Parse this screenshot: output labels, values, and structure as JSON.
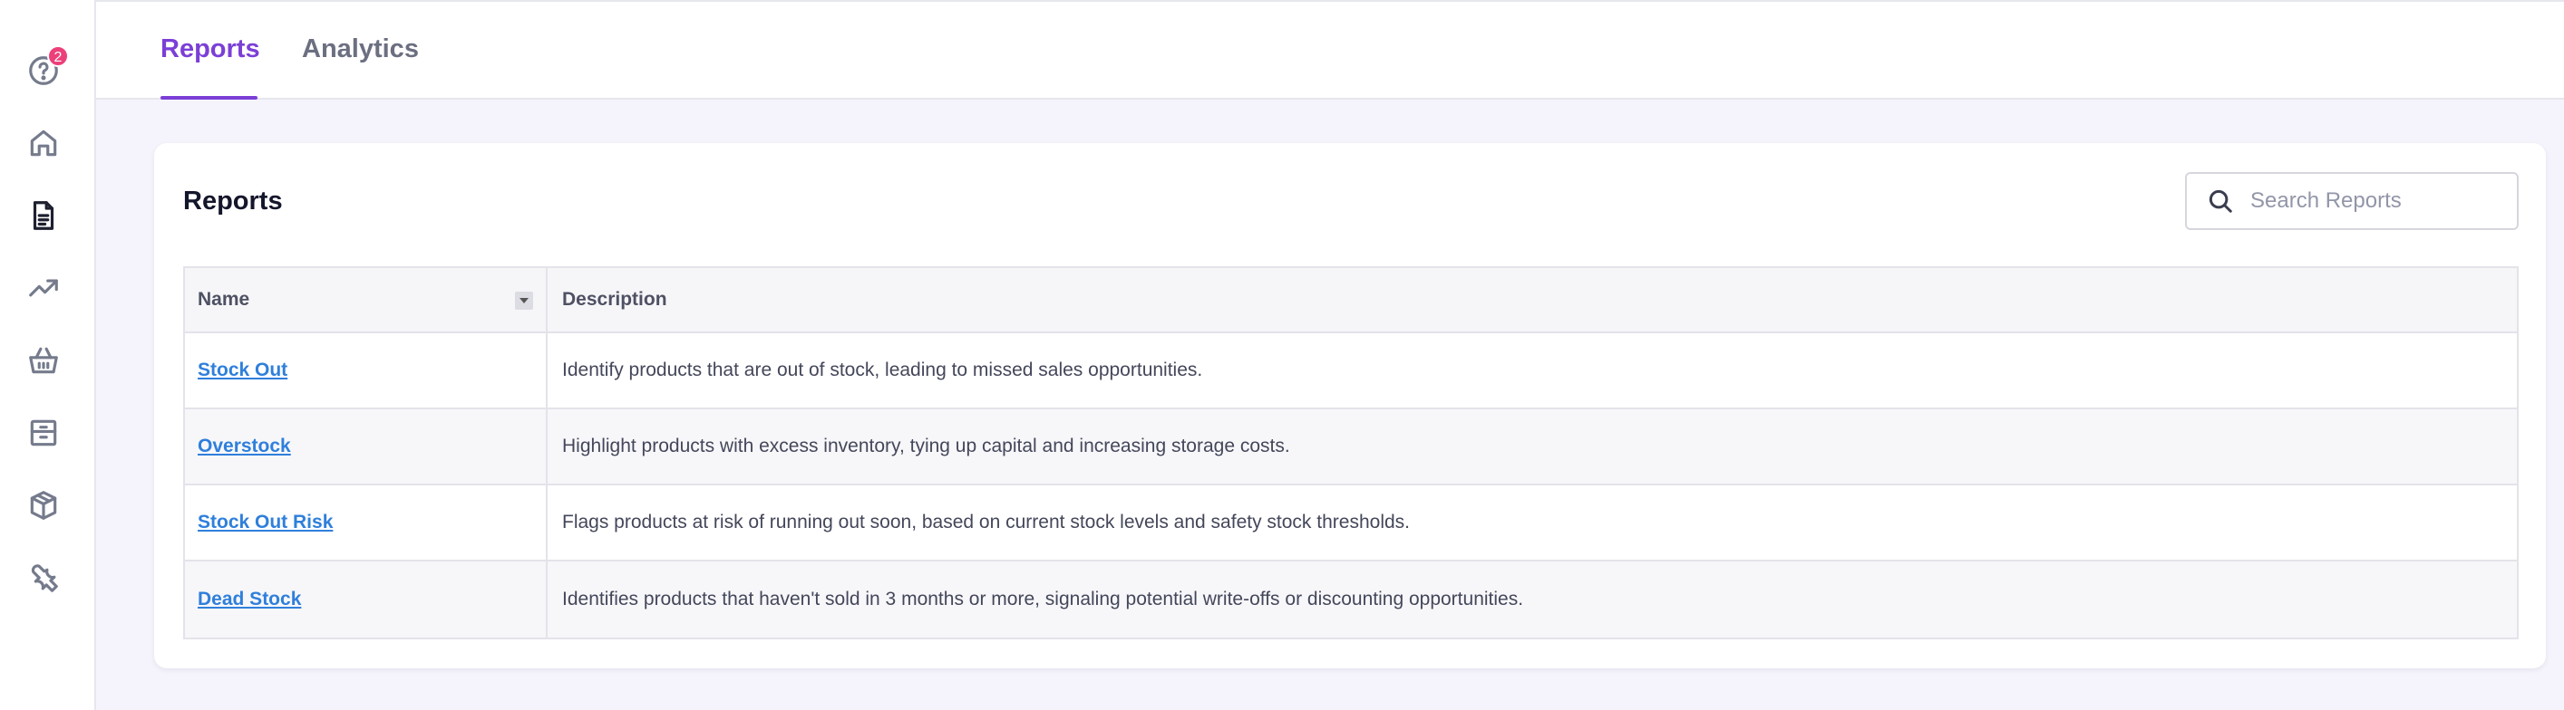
{
  "sidebar": {
    "help_badge_count": "2",
    "items": [
      {
        "icon": "help-circle-icon"
      },
      {
        "icon": "home-icon"
      },
      {
        "icon": "document-icon",
        "active": true
      },
      {
        "icon": "trending-up-icon"
      },
      {
        "icon": "basket-icon"
      },
      {
        "icon": "archive-box-icon"
      },
      {
        "icon": "package-icon"
      },
      {
        "icon": "wrench-icon"
      }
    ]
  },
  "tabs": [
    {
      "label": "Reports",
      "active": true
    },
    {
      "label": "Analytics",
      "active": false
    }
  ],
  "card": {
    "title": "Reports",
    "search_placeholder": "Search Reports"
  },
  "table": {
    "columns": [
      "Name",
      "Description"
    ],
    "rows": [
      {
        "name": "Stock Out",
        "description": "Identify products that are out of stock, leading to missed sales opportunities."
      },
      {
        "name": "Overstock",
        "description": "Highlight products with excess inventory, tying up capital and increasing storage costs."
      },
      {
        "name": "Stock Out Risk",
        "description": "Flags products at risk of running out soon, based on current stock levels and safety stock thresholds."
      },
      {
        "name": "Dead Stock",
        "description": "Identifies products that haven't sold in 3 months or more, signaling potential write-offs or discounting opportunities."
      }
    ]
  },
  "colors": {
    "accent": "#7b3fd6",
    "link": "#2f7fdb",
    "badge": "#ec407a"
  }
}
